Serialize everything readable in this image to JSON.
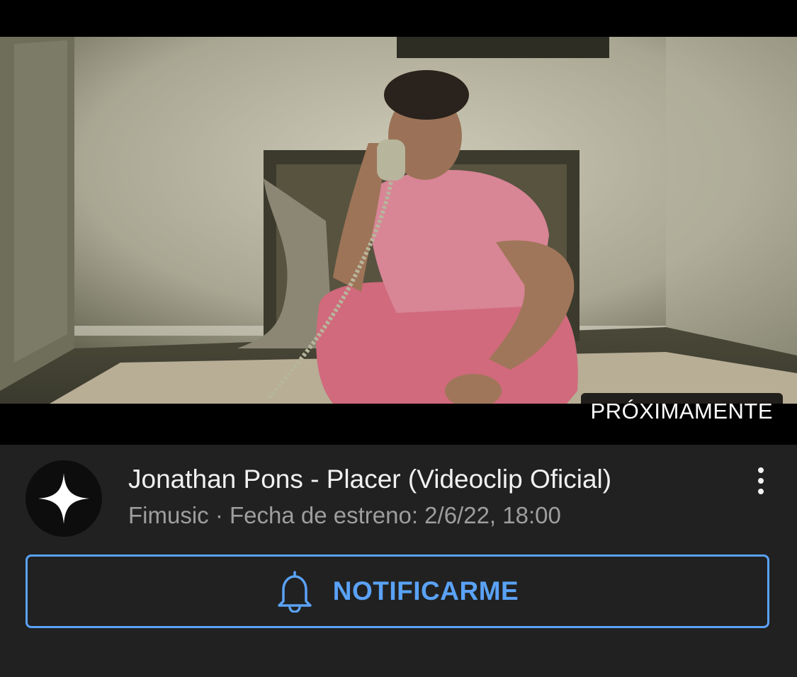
{
  "video": {
    "status_badge": "PRÓXIMAMENTE"
  },
  "details": {
    "title": "Jonathan Pons - Placer (Videoclip Oficial)",
    "channel": "Fimusic",
    "separator": " · ",
    "premiere": "Fecha de estreno: 2/6/22, 18:00",
    "avatar_icon": "sparkle-star-icon",
    "more_icon": "more-vertical-icon"
  },
  "actions": {
    "notify_label": "NOTIFICARME",
    "notify_icon": "bell-icon"
  },
  "colors": {
    "accent": "#5aa2f7",
    "background": "#212121"
  }
}
